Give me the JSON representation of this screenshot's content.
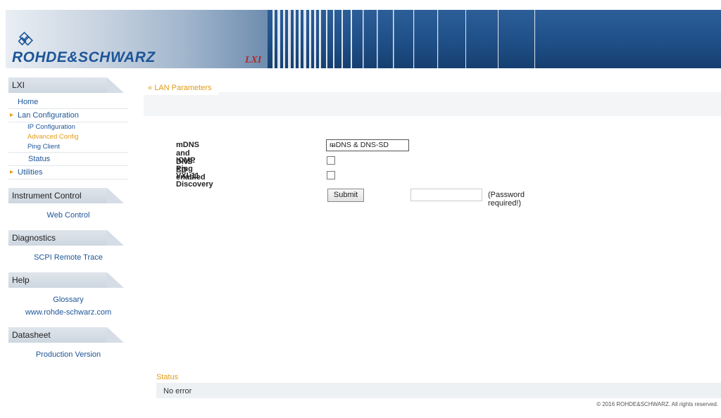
{
  "header": {
    "brand": "ROHDE&SCHWARZ",
    "product_mark": "LXI"
  },
  "sidebar": {
    "sections": [
      {
        "title": "LXI",
        "items": [
          {
            "label": "Home"
          },
          {
            "label": "Lan Configuration"
          },
          {
            "label": "IP Configuration"
          },
          {
            "label": "Advanced Config"
          },
          {
            "label": "Ping Client"
          },
          {
            "label": "Status"
          },
          {
            "label": "Utilities"
          }
        ]
      },
      {
        "title": "Instrument Control",
        "items": [
          {
            "label": "Web Control"
          }
        ]
      },
      {
        "title": "Diagnostics",
        "items": [
          {
            "label": "SCPI Remote Trace"
          }
        ]
      },
      {
        "title": "Help",
        "items": [
          {
            "label": "Glossary"
          },
          {
            "label": "www.rohde-schwarz.com"
          }
        ]
      },
      {
        "title": "Datasheet",
        "items": [
          {
            "label": "Production Version"
          }
        ]
      }
    ]
  },
  "main": {
    "page_title": "LAN Parameters",
    "fields": {
      "mdns_label": "mDNS and DNS-SD",
      "mdns_value": "mDNS & DNS-SD",
      "icmp_label": "ICMP Ping enabled",
      "icmp_checked": false,
      "vxi_label": "VXI-11 Discovery",
      "vxi_checked": false
    },
    "submit_label": "Submit",
    "password_value": "",
    "password_note": "(Password required!)"
  },
  "status": {
    "title": "Status",
    "message": "No error"
  },
  "footer": {
    "copyright": "© 2016 ROHDE&SCHWARZ. All rights reserved."
  },
  "colors": {
    "accent": "#e39b16",
    "link": "#1d5597",
    "banner": "#1f4f87"
  }
}
